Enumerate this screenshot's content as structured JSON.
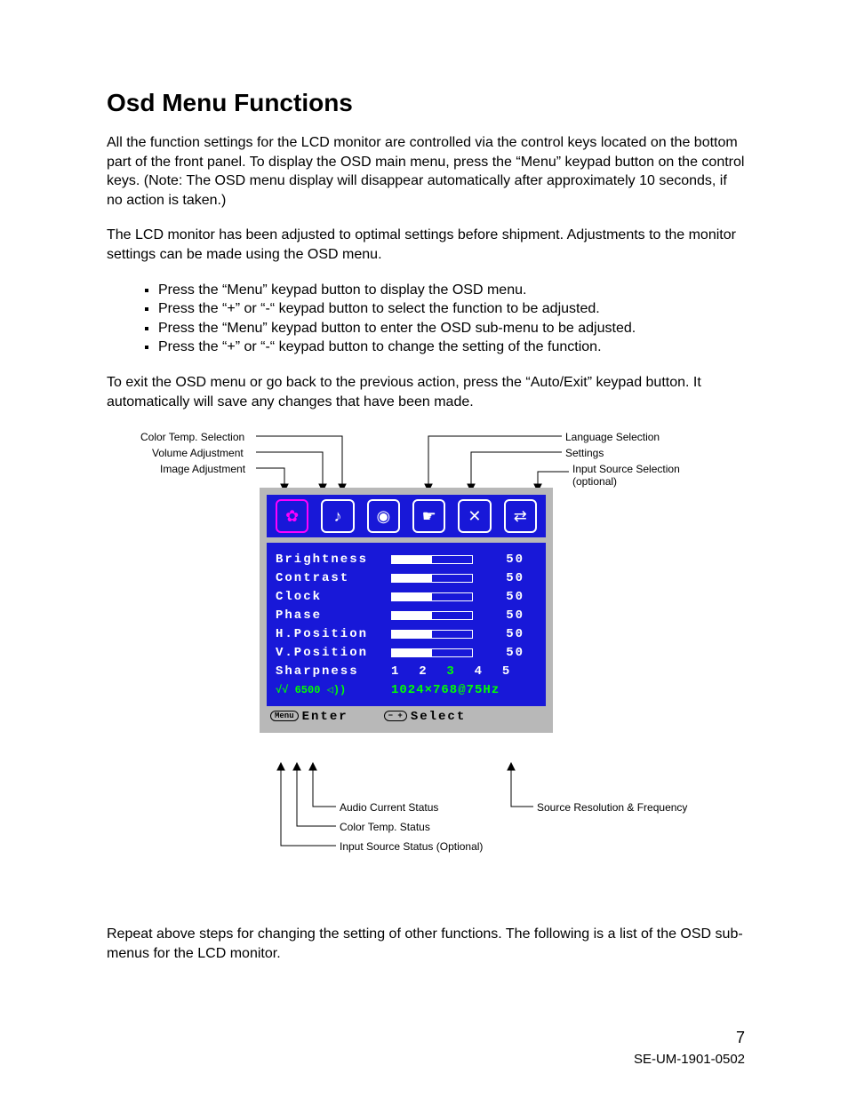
{
  "title": "Osd Menu Functions",
  "para1": "All the function settings for the LCD monitor are controlled via the control keys located on the bottom part of the front panel. To display the OSD main menu, press the “Menu” keypad button on the control keys. (Note: The OSD menu display will disappear automatically after approximately 10 seconds, if no action is taken.)",
  "para2": "The LCD monitor has been adjusted to optimal settings before shipment. Adjustments to the monitor settings can be made using the OSD menu.",
  "bullets": [
    "Press the “Menu” keypad button to display the OSD menu.",
    "Press the “+” or “-“ keypad button to select the function to be adjusted.",
    "Press the “Menu” keypad button to enter the OSD sub-menu to be adjusted.",
    "Press the “+” or “-“ keypad button to change the setting of the function."
  ],
  "para3": "To exit the OSD menu or go back to the previous action, press the “Auto/Exit” keypad button. It automatically will save any changes that have been made.",
  "diagram": {
    "labels": {
      "top_left": [
        "Color Temp. Selection",
        "Volume Adjustment",
        "Image Adjustment"
      ],
      "top_right": [
        "Language Selection",
        "Settings",
        "Input Source Selection (optional)"
      ],
      "bottom_left": [
        "Audio Current Status",
        "Color Temp. Status",
        "Input Source Status (Optional)"
      ],
      "bottom_right": "Source Resolution & Frequency"
    },
    "osd": {
      "rows": [
        {
          "name": "Brightness",
          "value": "50"
        },
        {
          "name": "Contrast",
          "value": "50"
        },
        {
          "name": "Clock",
          "value": "50"
        },
        {
          "name": "Phase",
          "value": "50"
        },
        {
          "name": "H.Position",
          "value": "50"
        },
        {
          "name": "V.Position",
          "value": "50"
        }
      ],
      "sharpness_label": "Sharpness",
      "sharpness_values": "1  2  3  4  5",
      "status_icons": "√√ 6500 ◁))",
      "resolution": "1024×768@75Hz",
      "footer_left_btn": "Menu",
      "footer_left": "Enter",
      "footer_right_btn": "− +",
      "footer_right": "Select"
    }
  },
  "para4": "Repeat above steps for changing the setting of other functions. The following is a list of the OSD sub-menus for the LCD monitor.",
  "page_number": "7",
  "doc_id": "SE-UM-1901-0502"
}
